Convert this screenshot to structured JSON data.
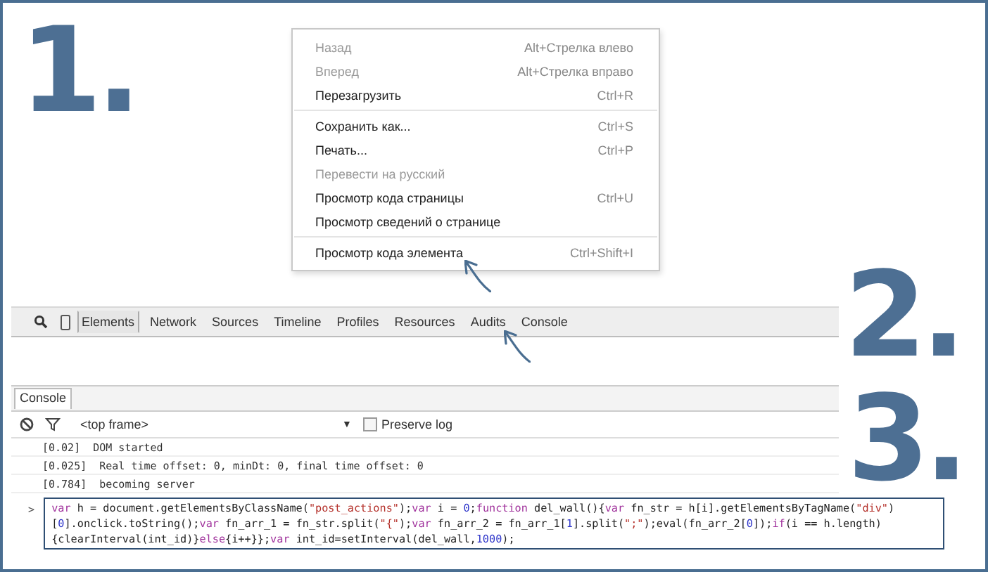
{
  "steps": [
    "1.",
    "2.",
    "3."
  ],
  "context_menu": {
    "groups": [
      [
        {
          "label": "Назад",
          "shortcut": "Alt+Стрелка влево",
          "disabled": true
        },
        {
          "label": "Вперед",
          "shortcut": "Alt+Стрелка вправо",
          "disabled": true
        },
        {
          "label": "Перезагрузить",
          "shortcut": "Ctrl+R",
          "disabled": false
        }
      ],
      [
        {
          "label": "Сохранить как...",
          "shortcut": "Ctrl+S",
          "disabled": false
        },
        {
          "label": "Печать...",
          "shortcut": "Ctrl+P",
          "disabled": false
        },
        {
          "label": "Перевести на русский",
          "disabled": true
        },
        {
          "label": "Просмотр кода страницы",
          "shortcut": "Ctrl+U",
          "disabled": false
        },
        {
          "label": "Просмотр  сведений о странице",
          "disabled": false
        }
      ],
      [
        {
          "label": "Просмотр кода элемента",
          "shortcut": "Ctrl+Shift+I",
          "disabled": false
        }
      ]
    ]
  },
  "devtools_tabs": [
    {
      "label": "Elements",
      "selected": true
    },
    {
      "label": "Network",
      "selected": false
    },
    {
      "label": "Sources",
      "selected": false
    },
    {
      "label": "Timeline",
      "selected": false
    },
    {
      "label": "Profiles",
      "selected": false
    },
    {
      "label": "Resources",
      "selected": false
    },
    {
      "label": "Audits",
      "selected": false
    },
    {
      "label": "Console",
      "selected": false
    }
  ],
  "drawer": {
    "tab": "Console",
    "frame": "<top frame>",
    "dropdown": "▼",
    "preserve_log": {
      "label": "Preserve log",
      "checked": false
    }
  },
  "log": [
    "[0.02]  DOM started",
    "[0.025]  Real time offset: 0, minDt: 0, final time offset: 0",
    "[0.784]  becoming server"
  ],
  "prompt": ">",
  "code_lines": [
    [
      {
        "kind": "keyword",
        "text": "var"
      },
      {
        "kind": "plain",
        "text": " h = document.getElementsByClassName("
      },
      {
        "kind": "string",
        "text": "\"post_actions\""
      },
      {
        "kind": "plain",
        "text": ");"
      },
      {
        "kind": "keyword",
        "text": "var"
      },
      {
        "kind": "plain",
        "text": " i = "
      },
      {
        "kind": "number",
        "text": "0"
      },
      {
        "kind": "plain",
        "text": ";"
      },
      {
        "kind": "keyword",
        "text": "function"
      },
      {
        "kind": "plain",
        "text": " del_wall(){"
      },
      {
        "kind": "keyword",
        "text": "var"
      },
      {
        "kind": "plain",
        "text": " fn_str = h[i].getElementsByTagName("
      },
      {
        "kind": "string",
        "text": "\"div\""
      },
      {
        "kind": "plain",
        "text": ")"
      }
    ],
    [
      {
        "kind": "plain",
        "text": "["
      },
      {
        "kind": "number",
        "text": "0"
      },
      {
        "kind": "plain",
        "text": "].onclick.toString();"
      },
      {
        "kind": "keyword",
        "text": "var"
      },
      {
        "kind": "plain",
        "text": " fn_arr_1 = fn_str.split("
      },
      {
        "kind": "string",
        "text": "\"{\""
      },
      {
        "kind": "plain",
        "text": ");"
      },
      {
        "kind": "keyword",
        "text": "var"
      },
      {
        "kind": "plain",
        "text": " fn_arr_2 = fn_arr_1["
      },
      {
        "kind": "number",
        "text": "1"
      },
      {
        "kind": "plain",
        "text": "].split("
      },
      {
        "kind": "string",
        "text": "\";\""
      },
      {
        "kind": "plain",
        "text": ");eval(fn_arr_2["
      },
      {
        "kind": "number",
        "text": "0"
      },
      {
        "kind": "plain",
        "text": "]);"
      },
      {
        "kind": "keyword",
        "text": "if"
      },
      {
        "kind": "plain",
        "text": "(i == h.length)"
      }
    ],
    [
      {
        "kind": "plain",
        "text": "{clearInterval(int_id)}"
      },
      {
        "kind": "keyword",
        "text": "else"
      },
      {
        "kind": "plain",
        "text": "{i++}};"
      },
      {
        "kind": "keyword",
        "text": "var"
      },
      {
        "kind": "plain",
        "text": " int_id=setInterval(del_wall,"
      },
      {
        "kind": "number",
        "text": "1000"
      },
      {
        "kind": "plain",
        "text": ");"
      }
    ]
  ]
}
